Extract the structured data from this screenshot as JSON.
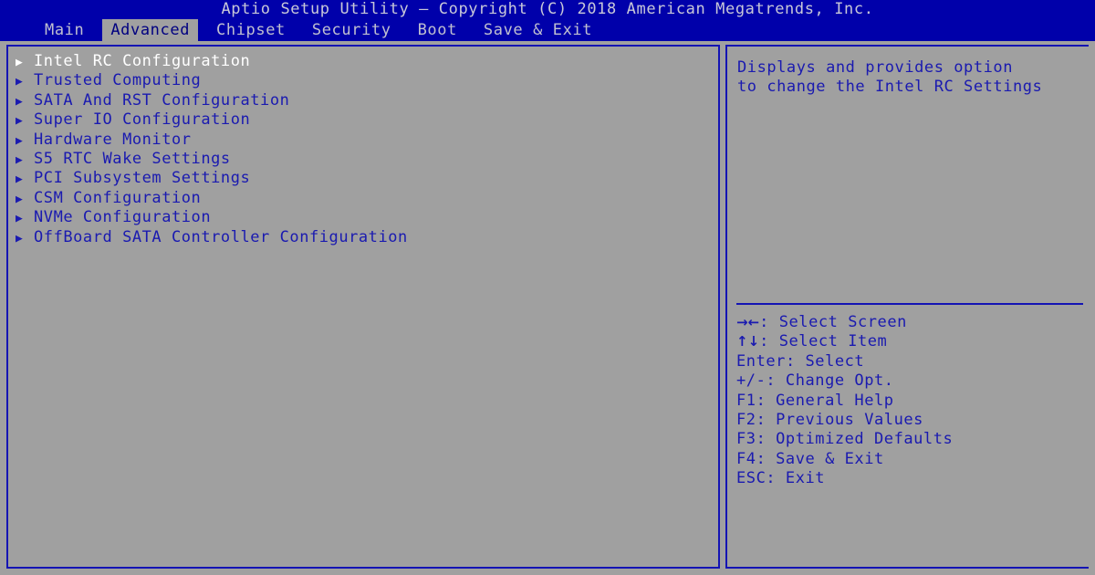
{
  "window": {
    "title": "Aptio Setup Utility – Copyright (C) 2018 American Megatrends, Inc.",
    "bg_color": "#a0a0a0",
    "accent_color": "#0000aa",
    "border_color": "#1414b4",
    "text_color": "#1a1ab0",
    "selected_text_color": "#ffffff"
  },
  "tabs": [
    {
      "label": "Main",
      "selected": false
    },
    {
      "label": "Advanced",
      "selected": true
    },
    {
      "label": "Chipset",
      "selected": false
    },
    {
      "label": "Security",
      "selected": false
    },
    {
      "label": "Boot",
      "selected": false
    },
    {
      "label": "Save & Exit",
      "selected": false
    }
  ],
  "menu": {
    "arrow_glyph": "▶",
    "items": [
      {
        "label": "Intel RC Configuration",
        "selected": true
      },
      {
        "label": "Trusted Computing",
        "selected": false
      },
      {
        "label": "SATA And RST Configuration",
        "selected": false
      },
      {
        "label": "Super IO Configuration",
        "selected": false
      },
      {
        "label": "Hardware Monitor",
        "selected": false
      },
      {
        "label": "S5 RTC Wake Settings",
        "selected": false
      },
      {
        "label": "PCI Subsystem Settings",
        "selected": false
      },
      {
        "label": "CSM Configuration",
        "selected": false
      },
      {
        "label": "NVMe Configuration",
        "selected": false
      },
      {
        "label": "OffBoard SATA Controller Configuration",
        "selected": false
      }
    ]
  },
  "help": {
    "text": "Displays and provides option\nto change the Intel RC Settings"
  },
  "legend": {
    "items": [
      {
        "key": "→←",
        "key_is_glyph": true,
        "text": ": Select Screen"
      },
      {
        "key": "↑↓",
        "key_is_glyph": true,
        "text": ": Select Item"
      },
      {
        "key": "Enter",
        "key_is_glyph": false,
        "text": ": Select"
      },
      {
        "key": "+/-",
        "key_is_glyph": false,
        "text": ": Change Opt."
      },
      {
        "key": "F1",
        "key_is_glyph": false,
        "text": ": General Help"
      },
      {
        "key": "F2",
        "key_is_glyph": false,
        "text": ": Previous Values"
      },
      {
        "key": "F3",
        "key_is_glyph": false,
        "text": ": Optimized Defaults"
      },
      {
        "key": "F4",
        "key_is_glyph": false,
        "text": ": Save & Exit"
      },
      {
        "key": "ESC",
        "key_is_glyph": false,
        "text": ": Exit"
      }
    ]
  }
}
